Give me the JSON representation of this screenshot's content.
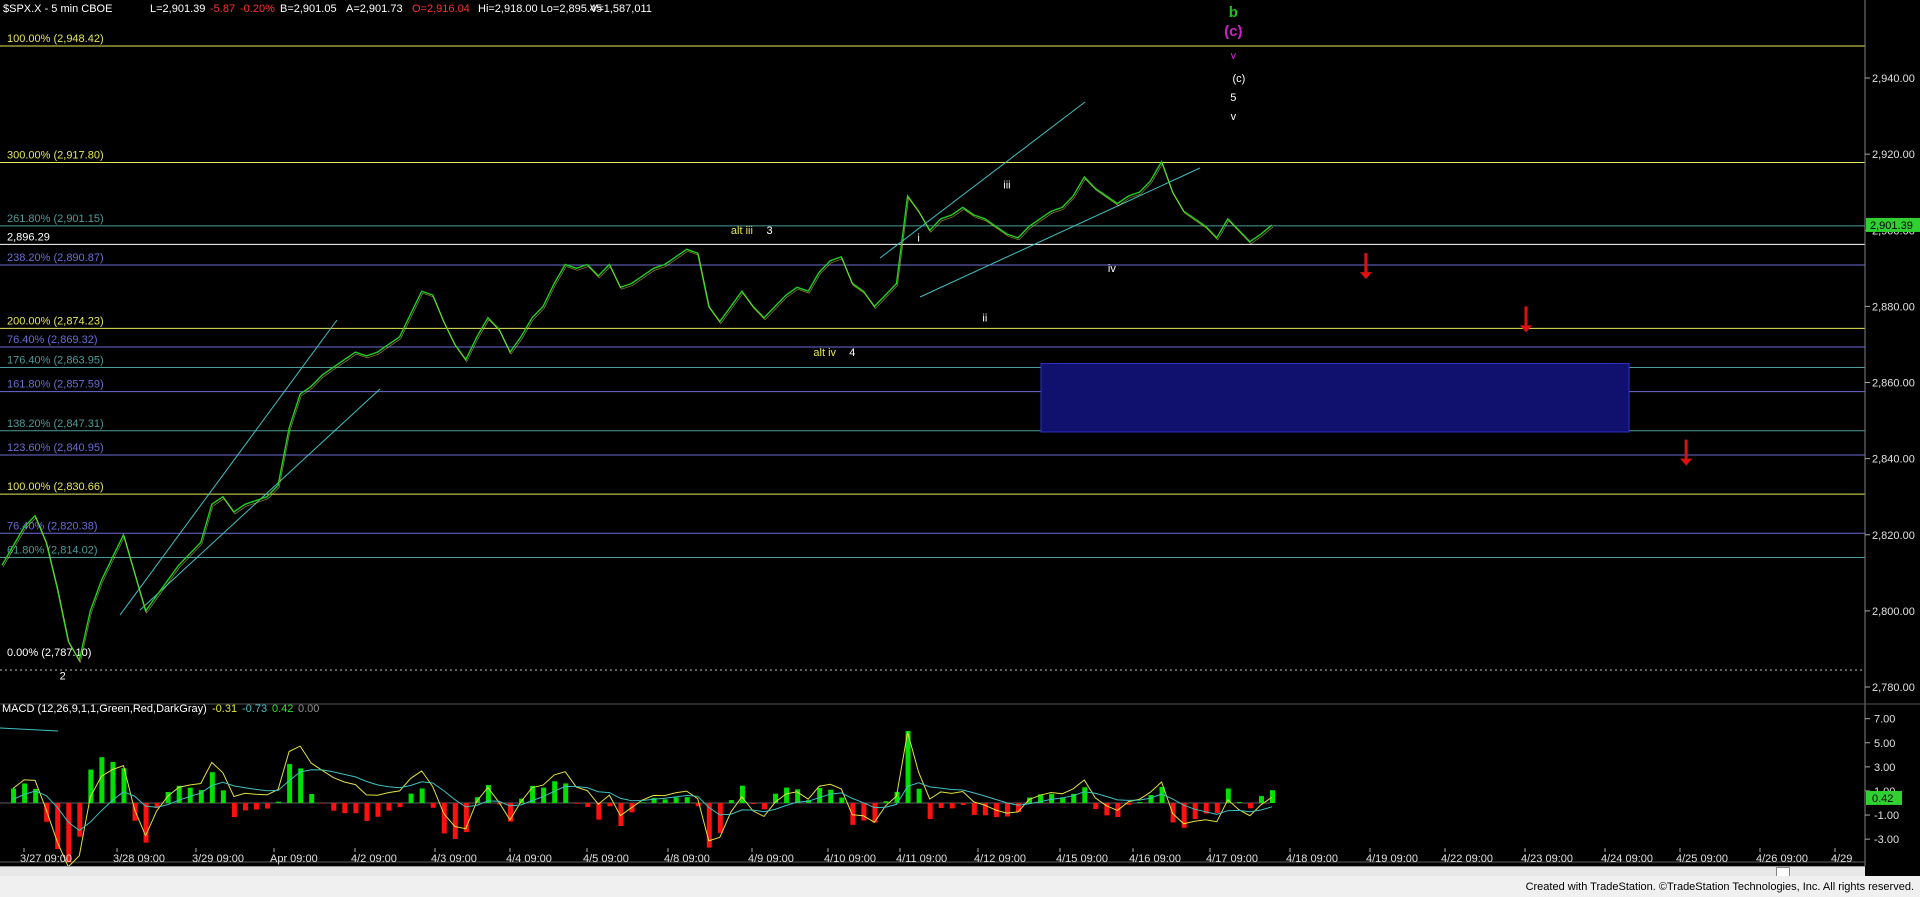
{
  "header": {
    "symbol": "$SPX.X - 5 min  CBOE",
    "last": "L=2,901.39",
    "change": "-5.87",
    "pct": "-0.20%",
    "bid": "B=2,901.05",
    "ask": "A=2,901.73",
    "open": "O=2,916.04",
    "hilo": "Hi=2,918.00  Lo=2,895.45",
    "volume": "V=1,587,011"
  },
  "colors": {
    "yellow_line": "#e6e65a",
    "blue_line": "#6b6bd6",
    "teal_line": "#4e9a9a",
    "channel": "#40c0c0",
    "box": "#10106e",
    "arrow": "#e01010",
    "macd_green": "#00e000",
    "macd_red": "#ff1010"
  },
  "chart_data": {
    "type": "line",
    "title": "",
    "ylim": [
      2770,
      2960
    ],
    "y_ticks": [
      "2,940.00",
      "2,920.00",
      "2,900.00",
      "2,880.00",
      "2,860.00",
      "2,840.00",
      "2,820.00",
      "2,800.00",
      "2,780.00"
    ],
    "last_price_label": "2,901.39",
    "x_ticks": [
      "3/27  09:00",
      "3/28  09:00",
      "3/29  09:00",
      "Apr  09:00",
      "4/2  09:00",
      "4/3  09:00",
      "4/4  09:00",
      "4/5  09:00",
      "4/8  09:00",
      "4/9  09:00",
      "4/10  09:00",
      "4/11  09:00",
      "4/12  09:00",
      "4/15  09:00",
      "4/16  09:00",
      "4/17  09:00",
      "4/18  09:00",
      "4/19  09:00",
      "4/22  09:00",
      "4/23  09:00",
      "4/24  09:00",
      "4/25  09:00",
      "4/26  09:00",
      "4/29"
    ],
    "price_series": [
      [
        0,
        2812
      ],
      [
        2,
        2817
      ],
      [
        4,
        2822
      ],
      [
        6,
        2825
      ],
      [
        8,
        2818
      ],
      [
        10,
        2806
      ],
      [
        12,
        2792
      ],
      [
        14,
        2787
      ],
      [
        16,
        2800
      ],
      [
        18,
        2808
      ],
      [
        20,
        2814
      ],
      [
        22,
        2820
      ],
      [
        24,
        2810
      ],
      [
        26,
        2800
      ],
      [
        28,
        2804
      ],
      [
        30,
        2808
      ],
      [
        32,
        2812
      ],
      [
        34,
        2815
      ],
      [
        36,
        2818
      ],
      [
        38,
        2828
      ],
      [
        40,
        2830
      ],
      [
        42,
        2826
      ],
      [
        44,
        2828
      ],
      [
        46,
        2829
      ],
      [
        48,
        2830
      ],
      [
        50,
        2833
      ],
      [
        52,
        2848
      ],
      [
        54,
        2857
      ],
      [
        56,
        2859
      ],
      [
        58,
        2862
      ],
      [
        60,
        2864
      ],
      [
        62,
        2866
      ],
      [
        64,
        2868
      ],
      [
        66,
        2867
      ],
      [
        68,
        2868
      ],
      [
        70,
        2870
      ],
      [
        72,
        2872
      ],
      [
        74,
        2878
      ],
      [
        76,
        2884
      ],
      [
        78,
        2883
      ],
      [
        80,
        2876
      ],
      [
        82,
        2870
      ],
      [
        84,
        2866
      ],
      [
        86,
        2872
      ],
      [
        88,
        2877
      ],
      [
        90,
        2874
      ],
      [
        92,
        2868
      ],
      [
        94,
        2872
      ],
      [
        96,
        2877
      ],
      [
        98,
        2880
      ],
      [
        100,
        2886
      ],
      [
        102,
        2891
      ],
      [
        104,
        2890
      ],
      [
        106,
        2891
      ],
      [
        108,
        2888
      ],
      [
        110,
        2891
      ],
      [
        112,
        2885
      ],
      [
        114,
        2886
      ],
      [
        116,
        2888
      ],
      [
        118,
        2890
      ],
      [
        120,
        2891
      ],
      [
        122,
        2893
      ],
      [
        124,
        2895
      ],
      [
        126,
        2894
      ],
      [
        128,
        2880
      ],
      [
        130,
        2876
      ],
      [
        132,
        2880
      ],
      [
        134,
        2884
      ],
      [
        136,
        2880
      ],
      [
        138,
        2877
      ],
      [
        140,
        2880
      ],
      [
        142,
        2883
      ],
      [
        144,
        2885
      ],
      [
        146,
        2884
      ],
      [
        148,
        2889
      ],
      [
        150,
        2892
      ],
      [
        152,
        2893
      ],
      [
        154,
        2886
      ],
      [
        156,
        2884
      ],
      [
        158,
        2880
      ],
      [
        160,
        2883
      ],
      [
        162,
        2886
      ],
      [
        164,
        2909
      ],
      [
        166,
        2905
      ],
      [
        168,
        2900
      ],
      [
        170,
        2903
      ],
      [
        172,
        2904
      ],
      [
        174,
        2906
      ],
      [
        176,
        2904
      ],
      [
        178,
        2903
      ],
      [
        180,
        2901
      ],
      [
        182,
        2899
      ],
      [
        184,
        2898
      ],
      [
        186,
        2901
      ],
      [
        188,
        2903
      ],
      [
        190,
        2905
      ],
      [
        192,
        2906
      ],
      [
        194,
        2909
      ],
      [
        196,
        2914
      ],
      [
        198,
        2911
      ],
      [
        200,
        2909
      ],
      [
        202,
        2907
      ],
      [
        204,
        2909
      ],
      [
        206,
        2910
      ],
      [
        208,
        2913
      ],
      [
        210,
        2918
      ],
      [
        212,
        2910
      ],
      [
        214,
        2905
      ],
      [
        216,
        2903
      ],
      [
        218,
        2901
      ],
      [
        220,
        2898
      ],
      [
        222,
        2903
      ],
      [
        224,
        2900
      ],
      [
        226,
        2897
      ],
      [
        228,
        2899
      ],
      [
        230,
        2901.39
      ]
    ],
    "fib_levels": [
      {
        "label": "100.00% (2,948.42)",
        "value": 2948.42,
        "color": "yellow"
      },
      {
        "label": "300.00% (2,917.80)",
        "value": 2917.8,
        "color": "yellow"
      },
      {
        "label": "261.80% (2,901.15)",
        "value": 2901.15,
        "color": "teal"
      },
      {
        "label": "2,896.29",
        "value": 2896.29,
        "color": "white"
      },
      {
        "label": "238.20% (2,890.87)",
        "value": 2890.87,
        "color": "blue"
      },
      {
        "label": "200.00% (2,874.23)",
        "value": 2874.23,
        "color": "yellow"
      },
      {
        "label": "76.40% (2,869.32)",
        "value": 2869.32,
        "color": "blue"
      },
      {
        "label": "176.40% (2,863.95)",
        "value": 2863.95,
        "color": "teal"
      },
      {
        "label": "161.80% (2,857.59)",
        "value": 2857.59,
        "color": "blue"
      },
      {
        "label": "138.20% (2,847.31)",
        "value": 2847.31,
        "color": "teal"
      },
      {
        "label": "123.60% (2,840.95)",
        "value": 2840.95,
        "color": "blue"
      },
      {
        "label": "100.00% (2,830.66)",
        "value": 2830.66,
        "color": "yellow"
      },
      {
        "label": "76.40% (2,820.38)",
        "value": 2820.38,
        "color": "blue"
      },
      {
        "label": "61.80% (2,814.02)",
        "value": 2814.02,
        "color": "teal"
      },
      {
        "label": "0.00% (2,787.10)",
        "value": 2787.1,
        "color": "white"
      }
    ],
    "target_box": {
      "x0": 196,
      "x1": 308,
      "y_top": 2865,
      "y_bottom": 2847
    },
    "wave_labels": [
      {
        "text": "b",
        "x": 223,
        "y": 2956,
        "color": "#20c020"
      },
      {
        "text": "(c)",
        "x": 223,
        "y": 2951,
        "color": "#d020d0"
      },
      {
        "text": "v",
        "x": 223,
        "y": 2945,
        "color": "#d020d0"
      },
      {
        "text": "(c)",
        "x": 224,
        "y": 2939,
        "color": "#ffffff"
      },
      {
        "text": "5",
        "x": 223,
        "y": 2934,
        "color": "#ffffff"
      },
      {
        "text": "v",
        "x": 223,
        "y": 2929,
        "color": "#ffffff"
      },
      {
        "text": "alt iii",
        "x": 134,
        "y": 2899,
        "color": "#e6e65a"
      },
      {
        "text": "3",
        "x": 139,
        "y": 2899,
        "color": "#ffffff"
      },
      {
        "text": "i",
        "x": 166,
        "y": 2897,
        "color": "#ffffff"
      },
      {
        "text": "iii",
        "x": 182,
        "y": 2911,
        "color": "#ffffff"
      },
      {
        "text": "iv",
        "x": 201,
        "y": 2889,
        "color": "#ffffff"
      },
      {
        "text": "ii",
        "x": 178,
        "y": 2876,
        "color": "#ffffff"
      },
      {
        "text": "alt iv",
        "x": 149,
        "y": 2867,
        "color": "#e6e65a"
      },
      {
        "text": "4",
        "x": 154,
        "y": 2867,
        "color": "#ffffff"
      },
      {
        "text": "2",
        "x": 11,
        "y": 2782,
        "color": "#ffffff"
      }
    ],
    "arrows": [
      {
        "x": 247,
        "y_from": 2894,
        "y_to": 2889
      },
      {
        "x": 276,
        "y_from": 2880,
        "y_to": 2875
      },
      {
        "x": 305,
        "y_from": 2845,
        "y_to": 2840
      }
    ],
    "macd": {
      "label": "MACD (12,26,9,1,1,Green,Red,DarkGray)",
      "values": [
        "-0.31",
        "-0.73",
        "0.42",
        "0.00"
      ],
      "ylim": [
        -4,
        8.5
      ],
      "y_ticks": [
        "7.00",
        "5.00",
        "3.00",
        "1.00",
        "-1.00",
        "-3.00"
      ],
      "current_label": "0.42"
    }
  },
  "footer": {
    "credit": "Created with TradeStation. ©TradeStation Technologies, Inc. All rights reserved."
  }
}
